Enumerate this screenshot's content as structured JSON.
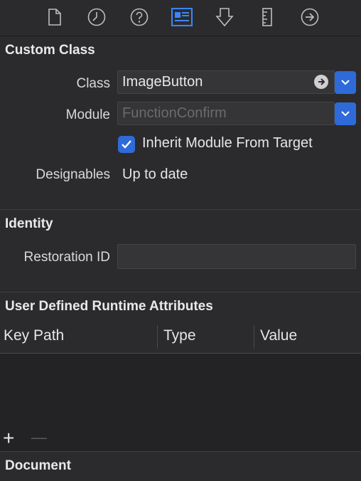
{
  "toolbar": {
    "icons": [
      "file-icon",
      "clock-icon",
      "help-icon",
      "identity-icon",
      "attributes-icon",
      "ruler-icon",
      "arrow-right-circle-icon"
    ],
    "active_icon": "identity-icon",
    "accent_color": "#2e6bd8"
  },
  "custom_class": {
    "title": "Custom Class",
    "class_label": "Class",
    "class_value": "ImageButton",
    "module_label": "Module",
    "module_placeholder": "FunctionConfirm",
    "inherit_label": "Inherit Module From Target",
    "inherit_checked": true,
    "designables_label": "Designables",
    "designables_value": "Up to date"
  },
  "identity": {
    "title": "Identity",
    "restoration_label": "Restoration ID",
    "restoration_value": ""
  },
  "runtime_attributes": {
    "title": "User Defined Runtime Attributes",
    "columns": [
      "Key Path",
      "Type",
      "Value"
    ],
    "add_label": "+",
    "remove_label": "—"
  },
  "document": {
    "title": "Document"
  }
}
